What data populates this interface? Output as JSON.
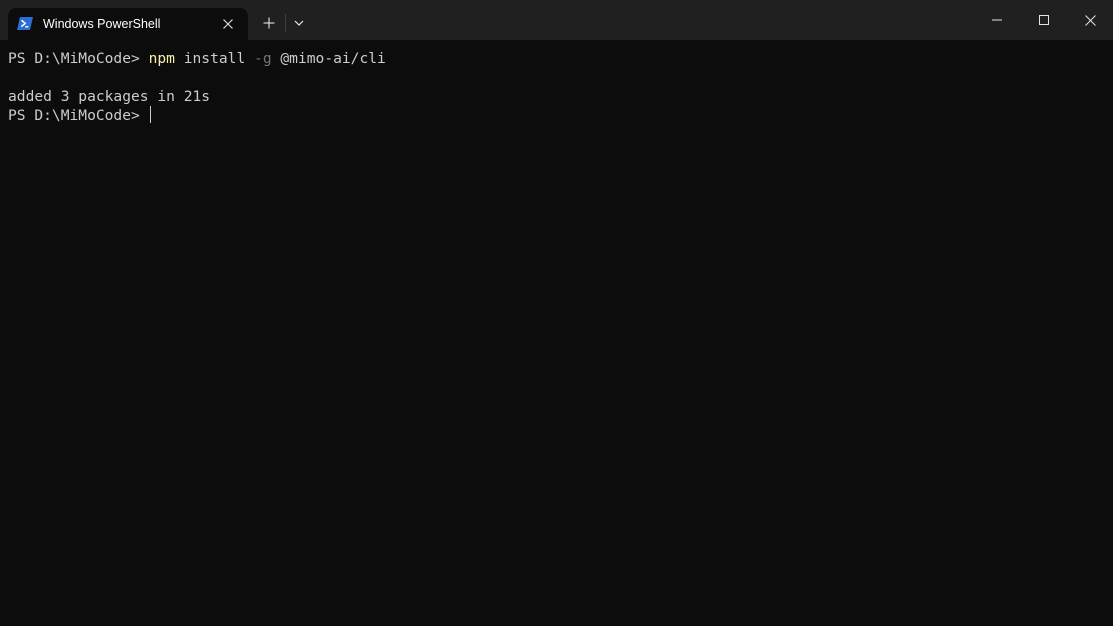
{
  "window": {
    "tab_title": "Windows PowerShell",
    "tab_icon": "powershell-icon",
    "colors": {
      "titlebar": "#202020",
      "terminal_bg": "#0c0c0c",
      "text": "#cccccc",
      "command": "#f9f1a5",
      "parameter": "#767676"
    }
  },
  "terminal": {
    "line1": {
      "prompt": "PS D:\\MiMoCode> ",
      "command": "npm",
      "arg1": " install ",
      "param": "-g",
      "arg2": " @mimo-ai/cli"
    },
    "line2": {
      "text": "added 3 packages in 21s"
    },
    "line3": {
      "prompt": "PS D:\\MiMoCode> "
    }
  }
}
